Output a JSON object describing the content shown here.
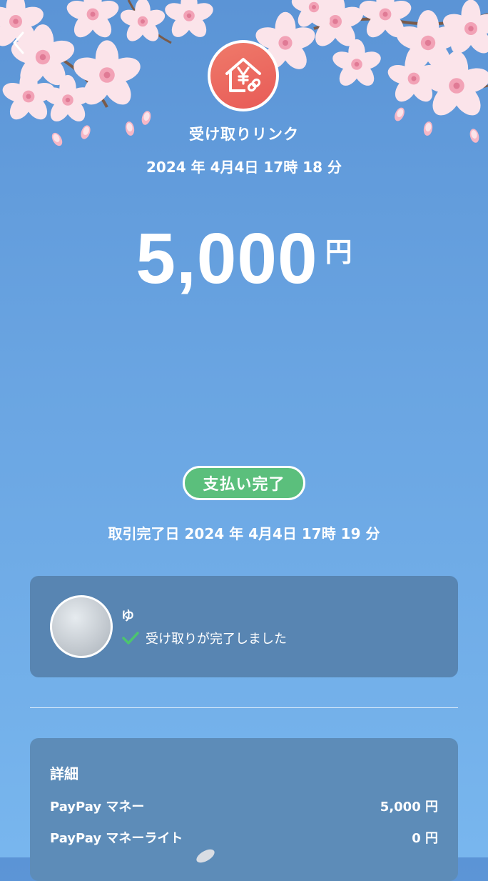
{
  "header": {
    "back_icon": "chevron-left-icon",
    "app_icon": "yen-house-link-icon"
  },
  "transaction": {
    "title": "受け取りリンク",
    "created_at": "2024 年 4月4日 17時 18 分",
    "amount": "5,000",
    "currency": "円",
    "status": "支払い完了",
    "status_color": "#5bbf7c",
    "completed_at": "取引完了日 2024 年 4月4日 17時 19 分"
  },
  "receiver": {
    "name": "ゆ",
    "status_text": "受け取りが完了しました",
    "status_icon": "check-icon",
    "check_color": "#4cc46f"
  },
  "details": {
    "title": "詳細",
    "rows": [
      {
        "label": "PayPay マネー",
        "value": "5,000 円"
      },
      {
        "label": "PayPay マネーライト",
        "value": "0 円"
      }
    ]
  },
  "colors": {
    "background_top": "#5b94d6",
    "background_bottom": "#78b6ee",
    "card": "#5885b2",
    "icon_gradient": "#e85b57"
  }
}
